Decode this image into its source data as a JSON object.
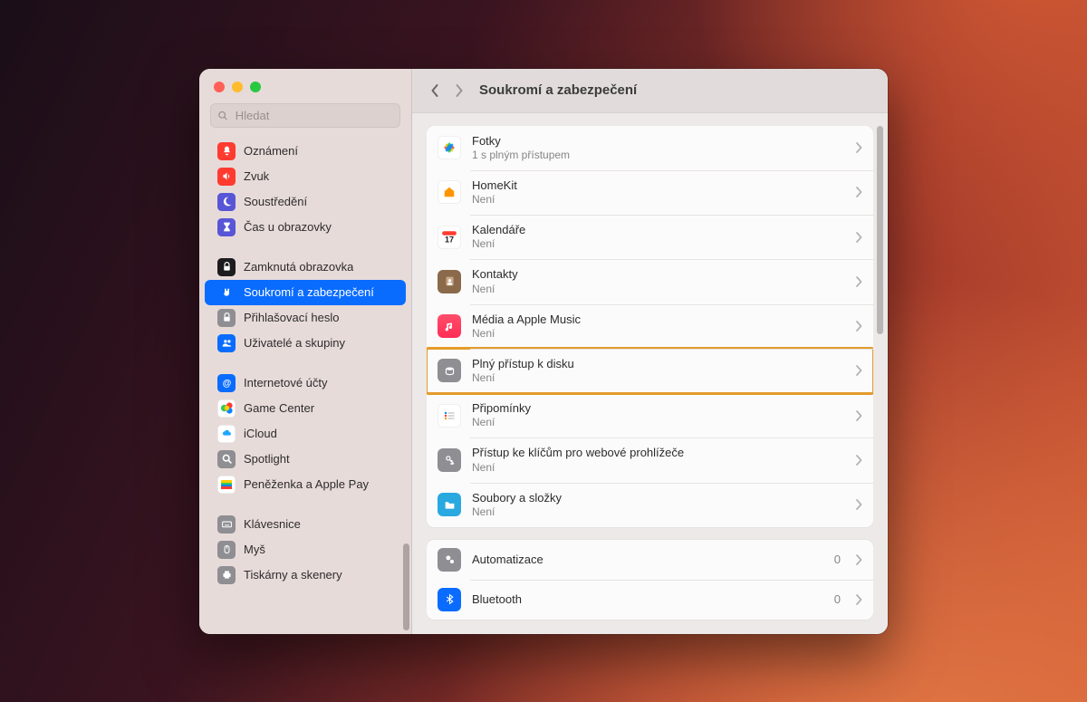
{
  "search": {
    "placeholder": "Hledat"
  },
  "header": {
    "title": "Soukromí a zabezpečení"
  },
  "sidebar": {
    "groups": [
      [
        {
          "label": "Oznámení",
          "icon_bg": "#ff3b30",
          "glyph": "bell"
        },
        {
          "label": "Zvuk",
          "icon_bg": "#ff3b30",
          "glyph": "speaker"
        },
        {
          "label": "Soustředění",
          "icon_bg": "#5856d6",
          "glyph": "moon"
        },
        {
          "label": "Čas u obrazovky",
          "icon_bg": "#5856d6",
          "glyph": "hourglass"
        }
      ],
      [
        {
          "label": "Zamknutá obrazovka",
          "icon_bg": "#1c1c1e",
          "glyph": "lock"
        },
        {
          "label": "Soukromí a zabezpečení",
          "icon_bg": "#0a6cff",
          "glyph": "hand",
          "selected": true
        },
        {
          "label": "Přihlašovací heslo",
          "icon_bg": "#8e8e93",
          "glyph": "lock"
        },
        {
          "label": "Uživatelé a skupiny",
          "icon_bg": "#0a6cff",
          "glyph": "users"
        }
      ],
      [
        {
          "label": "Internetové účty",
          "icon_bg": "#0a6cff",
          "glyph": "at"
        },
        {
          "label": "Game Center",
          "icon_bg": "#ffffff",
          "glyph": "gc"
        },
        {
          "label": "iCloud",
          "icon_bg": "#ffffff",
          "glyph": "cloud"
        },
        {
          "label": "Spotlight",
          "icon_bg": "#8e8e93",
          "glyph": "search"
        },
        {
          "label": "Peněženka a Apple Pay",
          "icon_bg": "#ffffff",
          "glyph": "wallet"
        }
      ],
      [
        {
          "label": "Klávesnice",
          "icon_bg": "#8e8e93",
          "glyph": "keyboard"
        },
        {
          "label": "Myš",
          "icon_bg": "#8e8e93",
          "glyph": "mouse"
        },
        {
          "label": "Tiskárny a skenery",
          "icon_bg": "#8e8e93",
          "glyph": "printer"
        }
      ]
    ]
  },
  "panels": [
    {
      "rows": [
        {
          "title": "Fotky",
          "subtitle": "1 s plným přístupem",
          "icon_bg": "linear-gradient(#fff,#fff)",
          "glyph": "photos"
        },
        {
          "title": "HomeKit",
          "subtitle": "Není",
          "icon_bg": "#ffffff",
          "glyph": "home"
        },
        {
          "title": "Kalendáře",
          "subtitle": "Není",
          "icon_bg": "#ffffff",
          "glyph": "calendar"
        },
        {
          "title": "Kontakty",
          "subtitle": "Není",
          "icon_bg": "#8a6a4a",
          "glyph": "contacts"
        },
        {
          "title": "Média a Apple Music",
          "subtitle": "Není",
          "icon_bg": "linear-gradient(#ff4e6b,#ff2d55)",
          "glyph": "music"
        },
        {
          "title": "Plný přístup k disku",
          "subtitle": "Není",
          "icon_bg": "#8e8e93",
          "glyph": "disk",
          "highlight": true
        },
        {
          "title": "Připomínky",
          "subtitle": "Není",
          "icon_bg": "#ffffff",
          "glyph": "reminders"
        },
        {
          "title": "Přístup ke klíčům pro webové prohlížeče",
          "subtitle": "Není",
          "icon_bg": "#8e8e93",
          "glyph": "key"
        },
        {
          "title": "Soubory a složky",
          "subtitle": "Není",
          "icon_bg": "#2aa8e0",
          "glyph": "folder"
        }
      ]
    },
    {
      "rows": [
        {
          "title": "Automatizace",
          "count": "0",
          "icon_bg": "#8e8e93",
          "glyph": "gears"
        },
        {
          "title": "Bluetooth",
          "count": "0",
          "icon_bg": "#0a6cff",
          "glyph": "bt"
        }
      ]
    }
  ]
}
